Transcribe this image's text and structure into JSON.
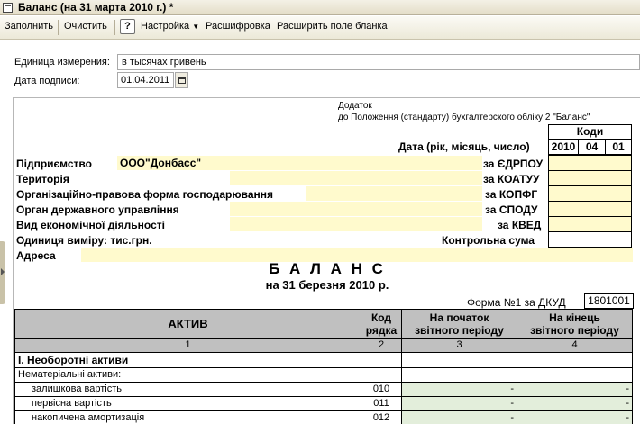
{
  "window": {
    "title": "Баланс (на 31 марта 2010 г.) *"
  },
  "toolbar": {
    "fill": "Заполнить",
    "clear": "Очистить",
    "help": "?",
    "settings": "Настройка",
    "decode": "Расшифровка",
    "expand": "Расширить поле бланка"
  },
  "header": {
    "unit_label": "Единица измерения:",
    "unit_value": "в тысячах гривень",
    "date_label": "Дата подписи:",
    "date_value": "01.04.2011"
  },
  "form": {
    "addendum_line1": "Додаток",
    "addendum_line2": "до Положення (стандарту) бухгалтерского обліку 2 \"Баланс\"",
    "codes_header": "Коди",
    "date_label": "Дата (рік, місяць, число)",
    "year": "2010",
    "month": "04",
    "day": "01",
    "enterprise_label": "Підприємство",
    "enterprise_value": "ООО\"Донбасс\"",
    "territory_label": "Територія",
    "org_form_label": "Організаційно-правова форма господарювання",
    "gov_body_label": "Орган державного управління",
    "activity_label": "Вид економічної діяльності",
    "unit_label": "Одиниця виміру: тис.грн.",
    "address_label": "Адреса",
    "edrpou_label": "за ЄДРПОУ",
    "koatuu_label": "за КОАТУУ",
    "kopfg_label": "за КОПФГ",
    "spodu_label": "за СПОДУ",
    "kved_label": "за КВЕД",
    "checksum_label": "Контрольна сума",
    "balance_title": "Б А Л А Н С",
    "balance_subtitle": "на 31 березня 2010 р.",
    "form_label": "Форма №1 за ДКУД",
    "form_code": "1801001"
  },
  "table": {
    "col_asset": "АКТИВ",
    "col_code_line1": "Код",
    "col_code_line2": "рядка",
    "col_start_line1": "На початок",
    "col_start_line2": "звітного періоду",
    "col_end_line1": "На кінець",
    "col_end_line2": "звітного періоду",
    "num1": "1",
    "num2": "2",
    "num3": "3",
    "num4": "4",
    "section1": "I. Необоротні активи",
    "rows": [
      {
        "label": "Нематеріальні активи:",
        "code": "",
        "start": "",
        "end": ""
      },
      {
        "label": "залишкова вартість",
        "code": "010",
        "start": "-",
        "end": "-"
      },
      {
        "label": "первісна вартість",
        "code": "011",
        "start": "-",
        "end": "-"
      },
      {
        "label": "накопичена амортизація",
        "code": "012",
        "start": "-",
        "end": "-"
      }
    ]
  },
  "colors": {
    "yellow_field": "#fffacd",
    "header_gray": "#c0c0c0",
    "value_green": "#e3eedb"
  }
}
